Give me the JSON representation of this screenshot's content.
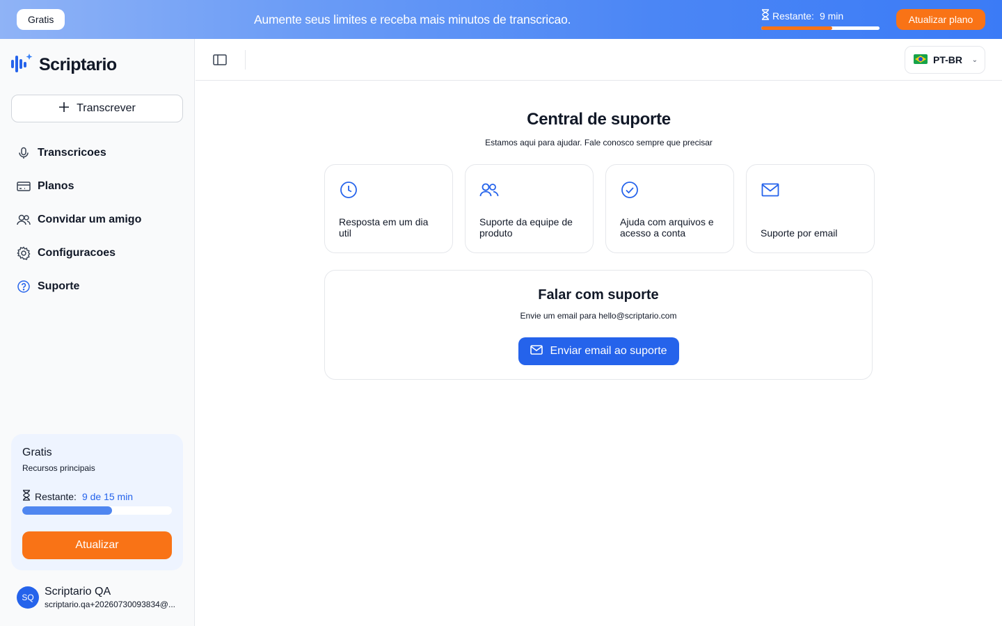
{
  "banner": {
    "plan_pill": "Gratis",
    "message": "Aumente seus limites e receba mais minutos de transcricao.",
    "remaining_label": "Restante:",
    "remaining_value": "9 min",
    "remaining_fraction": 0.6,
    "upgrade_label": "Atualizar plano"
  },
  "sidebar": {
    "logo_text": "Scriptario",
    "new_button": "Transcrever",
    "items": [
      {
        "label": "Transcricoes",
        "icon": "microphone-icon"
      },
      {
        "label": "Planos",
        "icon": "credit-card-icon"
      },
      {
        "label": "Convidar um amigo",
        "icon": "users-icon"
      },
      {
        "label": "Configuracoes",
        "icon": "gear-icon"
      },
      {
        "label": "Suporte",
        "icon": "help-circle-icon"
      }
    ],
    "plan": {
      "name": "Gratis",
      "description": "Recursos principais",
      "remaining_label": "Restante:",
      "remaining_value": "9 de 15 min",
      "remaining_fraction": 0.6,
      "button": "Atualizar"
    },
    "user": {
      "initials": "SQ",
      "name": "Scriptario QA",
      "email": "scriptario.qa+20260730093834@..."
    }
  },
  "header": {
    "language": "PT-BR"
  },
  "main": {
    "title": "Central de suporte",
    "subtitle": "Estamos aqui para ajudar. Fale conosco sempre que precisar",
    "cards": [
      {
        "text": "Resposta em um dia util",
        "icon": "clock-icon"
      },
      {
        "text": "Suporte da equipe de produto",
        "icon": "team-icon"
      },
      {
        "text": "Ajuda com arquivos e acesso a conta",
        "icon": "check-circle-icon"
      },
      {
        "text": "Suporte por email",
        "icon": "mail-icon"
      }
    ],
    "contact": {
      "title": "Falar com suporte",
      "subtitle": "Envie um email para hello@scriptario.com",
      "button": "Enviar email ao suporte"
    }
  },
  "colors": {
    "accent": "#2563eb",
    "cta": "#f97316"
  }
}
